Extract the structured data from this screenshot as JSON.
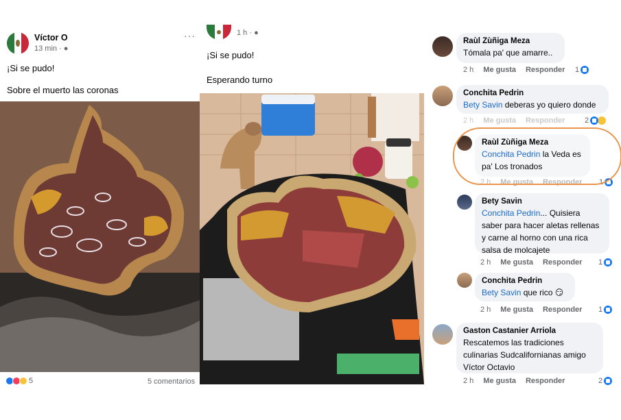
{
  "post1": {
    "author": "Víctor O",
    "time": "13 min · ",
    "more": "···",
    "line1": "¡Si se pudo!",
    "line2": "Sobre el muerto las coronas",
    "reaction_count": "5",
    "comments": "5 comentarios"
  },
  "post2": {
    "time": "1 h · ",
    "line1": "¡Si se pudo!",
    "line2": "Esperando turno"
  },
  "comments": [
    {
      "author": "Raùl Zùñiga Meza",
      "mention": "",
      "text": "Tómala pa' que amarre..",
      "time": "2 h",
      "like": "Me gusta",
      "reply": "Responder",
      "count": "1"
    },
    {
      "author": "Conchita Pedrin",
      "mention": "Bety Savin",
      "text": " deberas yo quiero donde",
      "time": "2 h",
      "like": "Me gusta",
      "reply": "Responder",
      "count": "2"
    },
    {
      "author": "Raùl Zùñiga Meza",
      "mention": "Conchita Pedrin",
      "text": " la Veda es pa' Los tronados",
      "time": "2 h",
      "like": "Me gusta",
      "reply": "Responder",
      "count": "1"
    },
    {
      "author": "Bety Savin",
      "mention": "Conchita Pedrin",
      "text": "... Quisiera saber para hacer aletas rellenas y carne al horno con una rica salsa de molcajete",
      "time": "2 h",
      "like": "Me gusta",
      "reply": "Responder",
      "count": "1"
    },
    {
      "author": "Conchita Pedrin",
      "mention": "Bety Savin",
      "text": " que rico 😏",
      "time": "2 h",
      "like": "Me gusta",
      "reply": "Responder",
      "count": "1"
    },
    {
      "author": "Gaston Castanier Arriola",
      "mention": "",
      "text": "Rescatemos las tradiciones culinarias Sudcalifornianas amigo Víctor Octavio",
      "time": "2 h",
      "like": "Me gusta",
      "reply": "Responder",
      "count": "2"
    }
  ],
  "colors": {
    "link": "#1b6ac9",
    "highlight": "#e8944a",
    "like": "#1877f2"
  }
}
